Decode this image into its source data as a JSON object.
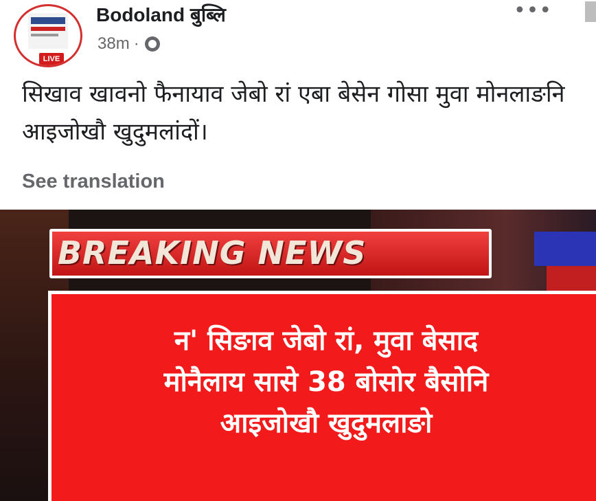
{
  "post": {
    "page_name": "Bodoland बुब्लि",
    "time": "38m",
    "meta_separator": "·",
    "avatar_badge": "LIVE",
    "more_icon": "more-horizontal-icon",
    "text": "सिखाव खावनो फैनायाव जेबो रां एबा बेसेन गोसा मुवा मोनलाङनि आइजोखौ खुदुमलांदों।",
    "see_translation": "See translation"
  },
  "media": {
    "banner_label": "BREAKING NEWS",
    "headline": "न' सिङाव जेबो रां, मुवा बेसाद\nमोनैलाय सासे 38 बोसोर बैसोनि\nआइजोखौ खुदुमलाङो"
  },
  "colors": {
    "headline_bg": "#f21a1a",
    "banner_bg": "#d42020",
    "meta_gray": "#65676b"
  }
}
